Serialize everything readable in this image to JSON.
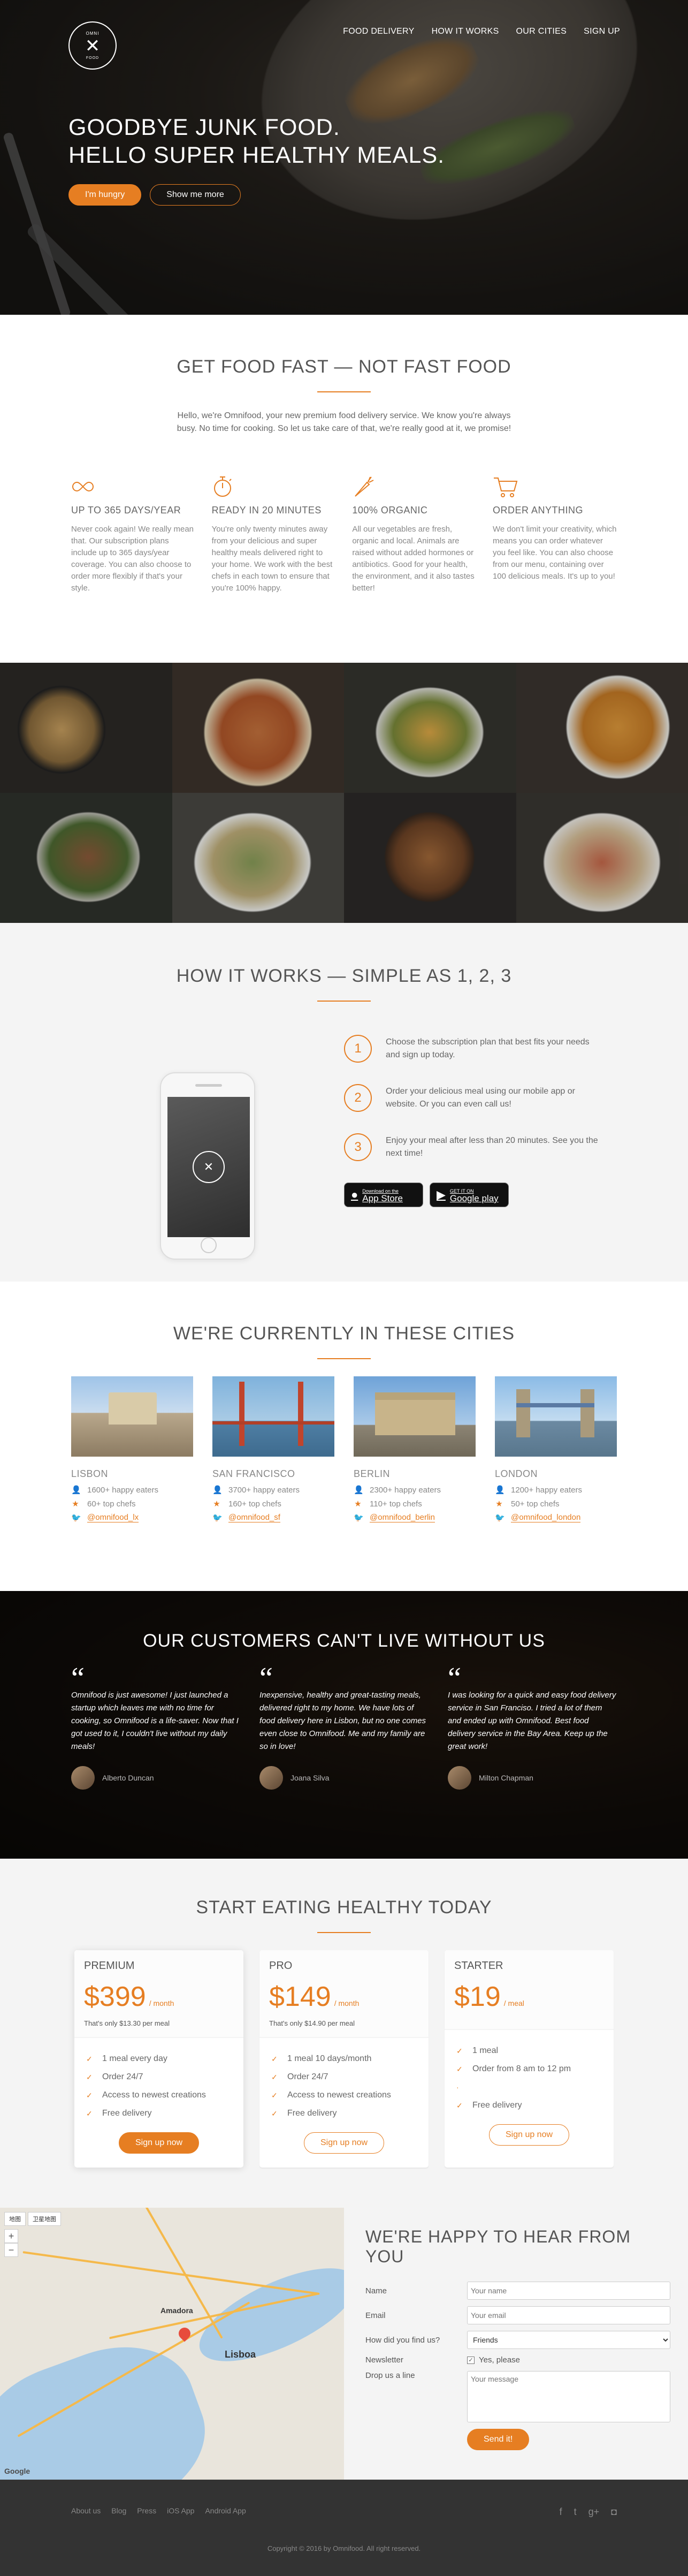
{
  "header": {
    "logo_glyph": "✕",
    "nav": [
      "FOOD DELIVERY",
      "HOW IT WORKS",
      "OUR CITIES",
      "SIGN UP"
    ],
    "headline_1": "GOODBYE JUNK FOOD.",
    "headline_2": "HELLO SUPER HEALTHY MEALS.",
    "cta_primary": "I'm hungry",
    "cta_secondary": "Show me more"
  },
  "features": {
    "title": "GET FOOD FAST — NOT FAST FOOD",
    "intro": "Hello, we're Omnifood, your new premium food delivery service. We know you're always busy. No time for cooking. So let us take care of that, we're really good at it, we promise!",
    "items": [
      {
        "icon": "infinity-icon",
        "title": "UP TO 365 DAYS/YEAR",
        "text": "Never cook again! We really mean that. Our subscription plans include up to 365 days/year coverage. You can also choose to order more flexibly if that's your style."
      },
      {
        "icon": "stopwatch-icon",
        "title": "READY IN 20 MINUTES",
        "text": "You're only twenty minutes away from your delicious and super healthy meals delivered right to your home. We work with the best chefs in each town to ensure that you're 100% happy."
      },
      {
        "icon": "carrot-icon",
        "title": "100% ORGANIC",
        "text": "All our vegetables are fresh, organic and local. Animals are raised without added hormones or antibiotics. Good for your health, the environment, and it also tastes better!"
      },
      {
        "icon": "cart-icon",
        "title": "ORDER ANYTHING",
        "text": "We don't limit your creativity, which means you can order whatever you feel like. You can also choose from our menu, containing over 100 delicious meals. It's up to you!"
      }
    ]
  },
  "steps": {
    "title": "HOW IT WORKS — SIMPLE AS 1, 2, 3",
    "items": [
      {
        "num": "1",
        "text": "Choose the subscription plan that best fits your needs and sign up today."
      },
      {
        "num": "2",
        "text": "Order your delicious meal using our mobile app or website. Or you can even call us!"
      },
      {
        "num": "3",
        "text": "Enjoy your meal after less than 20 minutes. See you the next time!"
      }
    ],
    "app_store": {
      "small": "Download on the",
      "big": "App Store"
    },
    "google_play": {
      "small": "GET IT ON",
      "big": "Google play"
    }
  },
  "cities": {
    "title": "WE'RE CURRENTLY IN THESE CITIES",
    "items": [
      {
        "name": "LISBON",
        "eaters": "1600+ happy eaters",
        "chefs": "60+ top chefs",
        "handle": "@omnifood_lx"
      },
      {
        "name": "SAN FRANCISCO",
        "eaters": "3700+ happy eaters",
        "chefs": "160+ top chefs",
        "handle": "@omnifood_sf"
      },
      {
        "name": "BERLIN",
        "eaters": "2300+ happy eaters",
        "chefs": "110+ top chefs",
        "handle": "@omnifood_berlin"
      },
      {
        "name": "LONDON",
        "eaters": "1200+ happy eaters",
        "chefs": "50+ top chefs",
        "handle": "@omnifood_london"
      }
    ]
  },
  "testimonials": {
    "title": "OUR CUSTOMERS CAN'T LIVE WITHOUT US",
    "quote_mark": "“",
    "items": [
      {
        "text": "Omnifood is just awesome! I just launched a startup which leaves me with no time for cooking, so Omnifood is a life-saver. Now that I got used to it, I couldn't live without my daily meals!",
        "author": "Alberto Duncan"
      },
      {
        "text": "Inexpensive, healthy and great-tasting meals, delivered right to my home. We have lots of food delivery here in Lisbon, but no one comes even close to Omnifood. Me and my family are so in love!",
        "author": "Joana Silva"
      },
      {
        "text": "I was looking for a quick and easy food delivery service in San Franciso. I tried a lot of them and ended up with Omnifood. Best food delivery service in the Bay Area. Keep up the great work!",
        "author": "Milton Chapman"
      }
    ]
  },
  "plans": {
    "title": "START EATING HEALTHY TODAY",
    "items": [
      {
        "name": "PREMIUM",
        "price": "$399",
        "per": "/ month",
        "sub": "That's only $13.30 per meal",
        "features": [
          "1 meal every day",
          "Order 24/7",
          "Access to newest creations",
          "Free delivery"
        ],
        "cta": "Sign up now"
      },
      {
        "name": "PRO",
        "price": "$149",
        "per": "/ month",
        "sub": "That's only $14.90 per meal",
        "features": [
          "1 meal 10 days/month",
          "Order 24/7",
          "Access to newest creations",
          "Free delivery"
        ],
        "cta": "Sign up now"
      },
      {
        "name": "STARTER",
        "price": "$19",
        "per": "/ meal",
        "sub": "",
        "features": [
          "1 meal",
          "Order from 8 am to 12 pm",
          "",
          "Free delivery"
        ],
        "cta": "Sign up now"
      }
    ]
  },
  "contact": {
    "title": "WE'RE HAPPY TO HEAR FROM YOU",
    "map_controls": [
      "地图",
      "卫星地图"
    ],
    "map_city": "Lisboa",
    "map_town": "Amadora",
    "map_logo": "Google",
    "fields": {
      "name_label": "Name",
      "name_placeholder": "Your name",
      "email_label": "Email",
      "email_placeholder": "Your email",
      "find_label": "How did you find us?",
      "find_value": "Friends",
      "news_label": "Newsletter",
      "news_value": "Yes, please",
      "msg_label": "Drop us a line",
      "msg_placeholder": "Your message"
    },
    "submit": "Send it!"
  },
  "footer": {
    "links": [
      "About us",
      "Blog",
      "Press",
      "iOS App",
      "Android App"
    ],
    "social": [
      {
        "icon": "facebook-icon",
        "glyph": "f"
      },
      {
        "icon": "twitter-icon",
        "glyph": "t"
      },
      {
        "icon": "googleplus-icon",
        "glyph": "g+"
      },
      {
        "icon": "instagram-icon",
        "glyph": "◘"
      }
    ],
    "copyright": "Copyright © 2016 by Omnifood. All right reserved."
  },
  "colors": {
    "accent": "#e67e22",
    "dark": "#333333",
    "light_bg": "#f4f4f4"
  }
}
